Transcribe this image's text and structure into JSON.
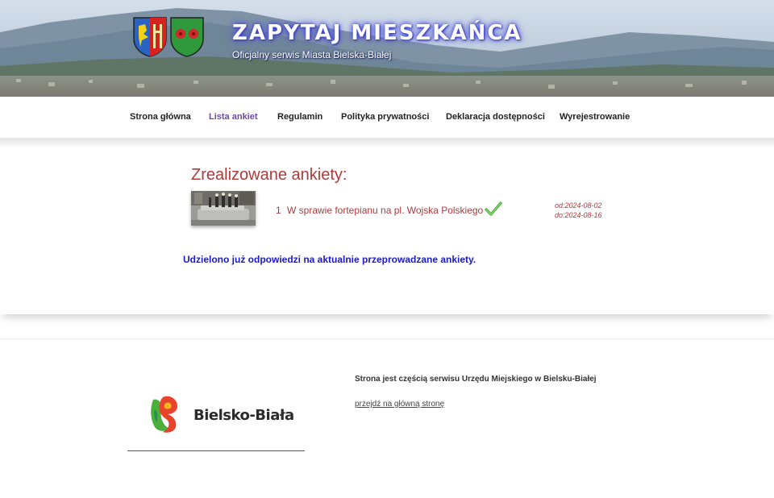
{
  "header": {
    "title": "ZAPYTAJ MIESZKAŃCA",
    "subtitle": "Oficjalny serwis Miasta Bielska-Białej"
  },
  "nav": {
    "items": [
      {
        "label": "Strona główna",
        "active": false
      },
      {
        "label": "Lista ankiet",
        "active": true
      },
      {
        "label": "Regulamin",
        "active": false
      },
      {
        "label": "Polityka prywatności",
        "active": false
      },
      {
        "label": "Deklaracja dostępności",
        "active": false
      },
      {
        "label": "Wyrejestrowanie",
        "active": false
      }
    ]
  },
  "main": {
    "heading": "Zrealizowane ankiety:",
    "surveys": [
      {
        "number": "1",
        "title": "W sprawie fortepianu na pl. Wojska Polskiego",
        "date_from": "od:2024-08-02",
        "date_to": "do:2024-08-16",
        "status_icon": "check-icon"
      }
    ],
    "notice": "Udzielono już odpowiedzi na aktualnie przeprowadzane ankiety."
  },
  "footer": {
    "logo_text": "Bielsko-Biała",
    "info": "Strona jest częścią serwisu Urzędu Miejskiego w Bielsku-Białej",
    "link": "przejdź na główną stronę"
  },
  "colors": {
    "accent_red": "#b03a3a",
    "nav_active": "#6b4aa8",
    "notice_blue": "#1a1ad0",
    "check_green": "#3fae2a"
  }
}
